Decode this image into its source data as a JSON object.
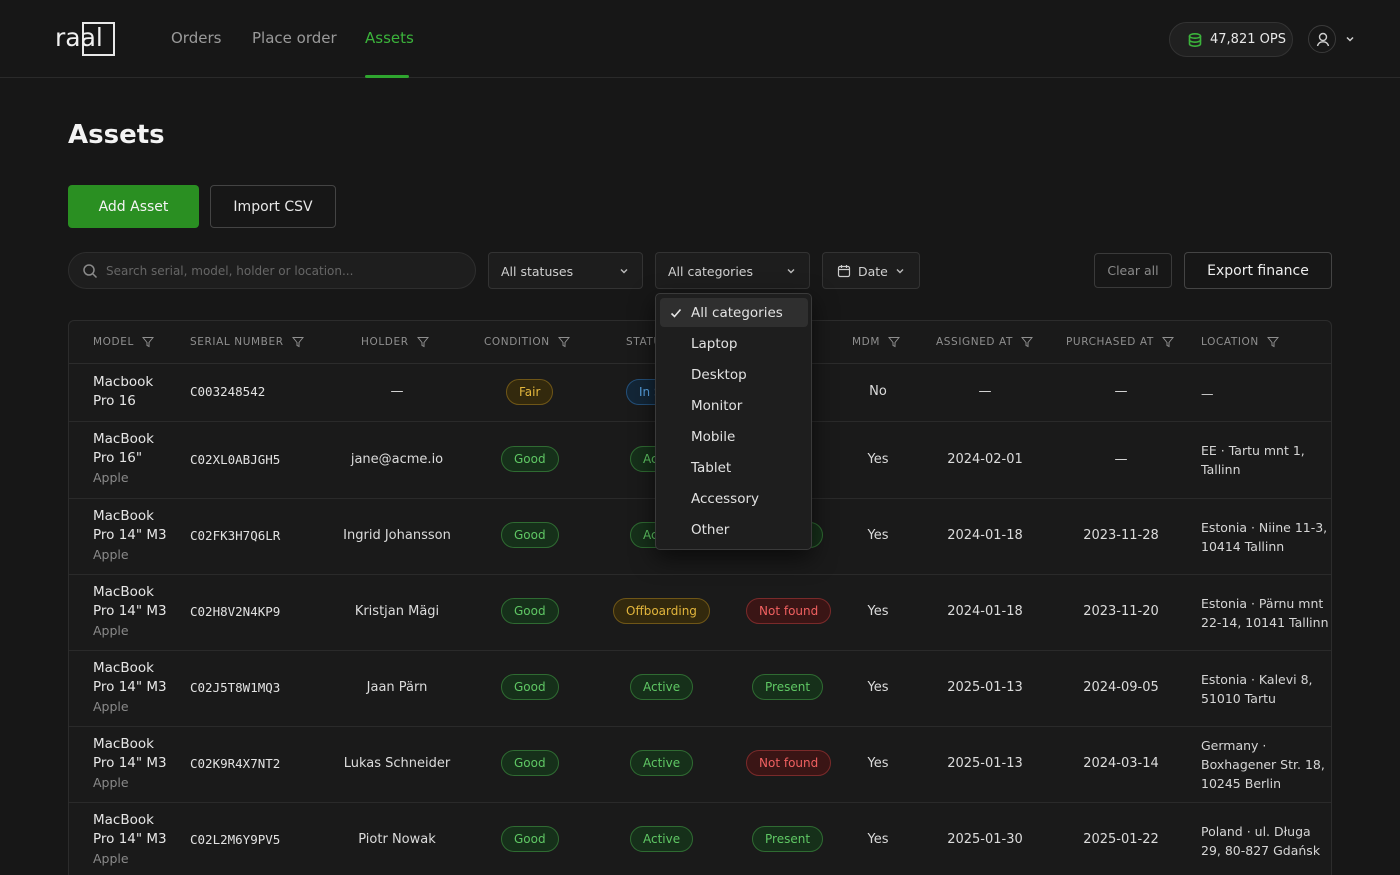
{
  "nav": {
    "logo": "raal",
    "links": [
      "Orders",
      "Place order",
      "Assets"
    ],
    "active": "Assets",
    "ops_balance": "47,821 OPS"
  },
  "page": {
    "title": "Assets",
    "add_button": "Add Asset",
    "import_button": "Import CSV"
  },
  "filters": {
    "search_placeholder": "Search serial, model, holder or location...",
    "status_select": "All statuses",
    "category_select": "All categories",
    "date_select": "Date",
    "clear_label": "Clear all",
    "export_label": "Export finance"
  },
  "category_menu": {
    "selected": "All categories",
    "options": [
      "All categories",
      "Laptop",
      "Desktop",
      "Monitor",
      "Mobile",
      "Tablet",
      "Accessory",
      "Other"
    ]
  },
  "table": {
    "columns": [
      "MODEL",
      "SERIAL NUMBER",
      "HOLDER",
      "CONDITION",
      "STATUS",
      "",
      "MDM",
      "ASSIGNED AT",
      "PURCHASED AT",
      "LOCATION"
    ],
    "rows": [
      {
        "model_line1": "Macbook",
        "model_line2": "Pro 16",
        "brand": "",
        "serial": "C003248542",
        "holder": "—",
        "condition": "Fair",
        "status": "In Stock",
        "presence": "",
        "mdm": "No",
        "assigned": "—",
        "purchased": "—",
        "location": "—"
      },
      {
        "model_line1": "MacBook",
        "model_line2": "Pro 16\"",
        "brand": "Apple",
        "serial": "C02XL0ABJGH5",
        "holder": "jane@acme.io",
        "condition": "Good",
        "status": "Active",
        "presence": "",
        "mdm": "Yes",
        "assigned": "2024-02-01",
        "purchased": "—",
        "location": "EE · Tartu mnt 1, Tallinn"
      },
      {
        "model_line1": "MacBook",
        "model_line2": "Pro 14\" M3",
        "brand": "Apple",
        "serial": "C02FK3H7Q6LR",
        "holder": "Ingrid Johansson",
        "condition": "Good",
        "status": "Active",
        "presence": "Present",
        "mdm": "Yes",
        "assigned": "2024-01-18",
        "purchased": "2023-11-28",
        "location": "Estonia · Niine 11-3, 10414 Tallinn"
      },
      {
        "model_line1": "MacBook",
        "model_line2": "Pro 14\" M3",
        "brand": "Apple",
        "serial": "C02H8V2N4KP9",
        "holder": "Kristjan Mägi",
        "condition": "Good",
        "status": "Offboarding",
        "presence": "Not found",
        "mdm": "Yes",
        "assigned": "2024-01-18",
        "purchased": "2023-11-20",
        "location": "Estonia · Pärnu mnt 22-14, 10141 Tallinn"
      },
      {
        "model_line1": "MacBook",
        "model_line2": "Pro 14\" M3",
        "brand": "Apple",
        "serial": "C02J5T8W1MQ3",
        "holder": "Jaan Pärn",
        "condition": "Good",
        "status": "Active",
        "presence": "Present",
        "mdm": "Yes",
        "assigned": "2025-01-13",
        "purchased": "2024-09-05",
        "location": "Estonia · Kalevi 8, 51010 Tartu"
      },
      {
        "model_line1": "MacBook",
        "model_line2": "Pro 14\" M3",
        "brand": "Apple",
        "serial": "C02K9R4X7NT2",
        "holder": "Lukas Schneider",
        "condition": "Good",
        "status": "Active",
        "presence": "Not found",
        "mdm": "Yes",
        "assigned": "2025-01-13",
        "purchased": "2024-03-14",
        "location": "Germany · Boxhagener Str. 18, 10245 Berlin"
      },
      {
        "model_line1": "MacBook",
        "model_line2": "Pro 14\" M3",
        "brand": "Apple",
        "serial": "C02L2M6Y9PV5",
        "holder": "Piotr Nowak",
        "condition": "Good",
        "status": "Active",
        "presence": "Present",
        "mdm": "Yes",
        "assigned": "2025-01-30",
        "purchased": "2025-01-22",
        "location": "Poland · ul. Długa 29, 80-827 Gdańsk"
      }
    ]
  },
  "colors": {
    "accent": "#2a8f22",
    "background": "#171717",
    "good": "#5fc764",
    "warning": "#e2b53c",
    "danger": "#f06060",
    "info": "#58a4e6"
  }
}
